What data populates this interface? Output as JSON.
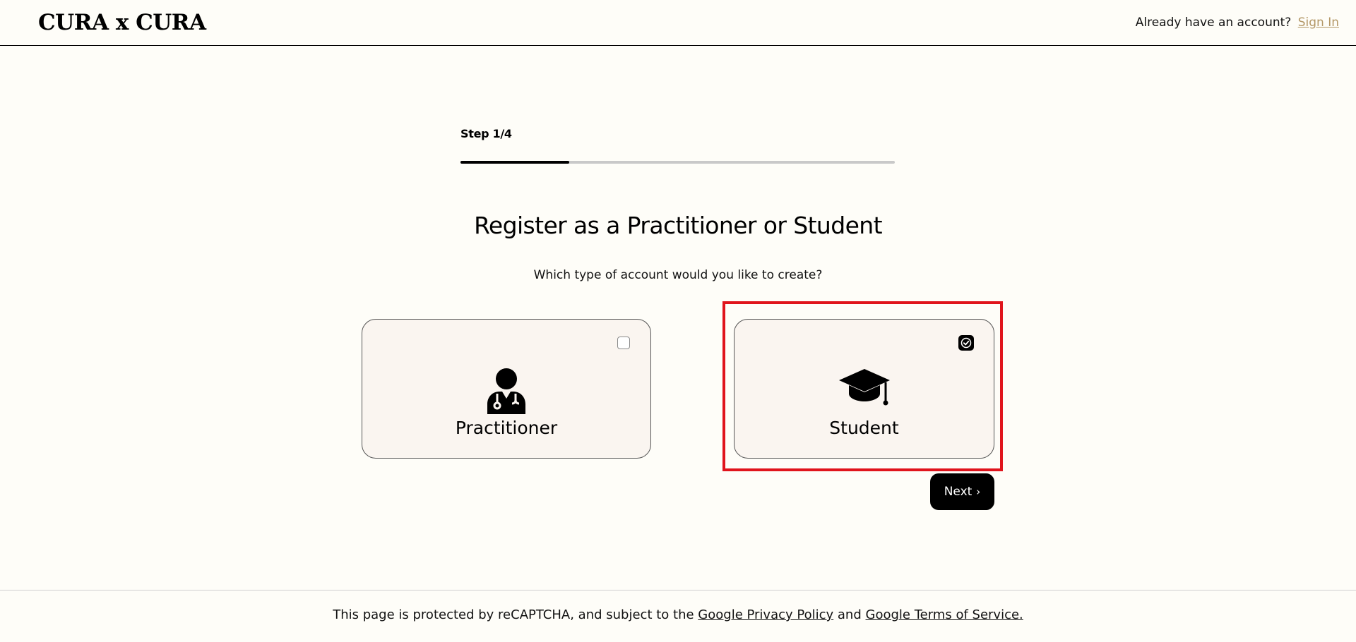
{
  "header": {
    "logo": "CURA x CURA",
    "account_prompt": "Already have an account?",
    "sign_in_label": "Sign In"
  },
  "step": {
    "label": "Step 1/4",
    "progress": 0.25
  },
  "main": {
    "title": "Register as a Practitioner or Student",
    "subtitle": "Which type of account would you like to create?"
  },
  "options": [
    {
      "label": "Practitioner",
      "icon": "doctor-icon",
      "selected": false
    },
    {
      "label": "Student",
      "icon": "graduation-cap-icon",
      "selected": true
    }
  ],
  "next_button": {
    "label": "Next",
    "icon": "chevron-right-icon"
  },
  "footer": {
    "text_prefix": "This page is protected by reCAPTCHA, and subject to the",
    "privacy_link": "Google Privacy Policy",
    "conjunction": "and",
    "terms_link": "Google Terms of Service."
  },
  "colors": {
    "background": "#fefdf8",
    "card_background": "#faf5f0",
    "accent_link": "#b39766",
    "selection_outline": "#e0141c",
    "button": "#000000"
  }
}
